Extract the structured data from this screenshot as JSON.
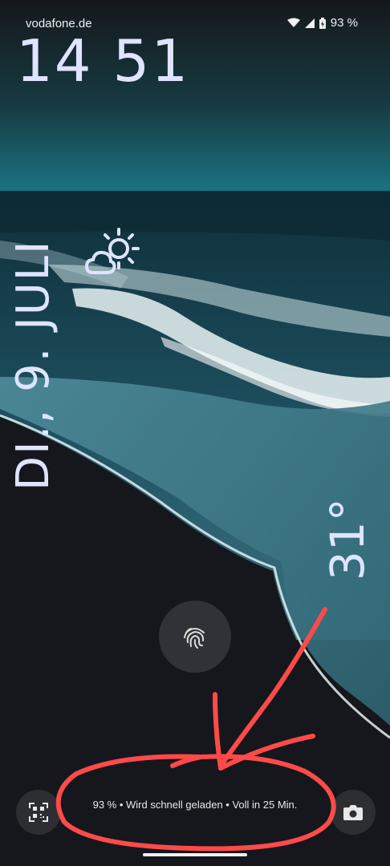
{
  "status_bar": {
    "carrier": "vodafone.de",
    "battery_percent": "93 %",
    "icons": [
      "wifi-icon",
      "cell-signal-icon",
      "battery-charging-icon"
    ]
  },
  "lockscreen": {
    "time": "14 51",
    "date": "DI., 9. JULI",
    "weather_icon": "partly-cloudy-icon",
    "temperature": "31°",
    "charging_status": "93 % • Wird schnell geladen • Voll in 25 Min."
  },
  "shortcuts": {
    "left_icon": "qr-code-scanner-icon",
    "right_icon": "camera-icon"
  },
  "colors": {
    "clock_text": "#dfe4ff",
    "annotation_red": "#ff4a4a",
    "sea": "#1a6e79",
    "sand": "#15171c"
  }
}
